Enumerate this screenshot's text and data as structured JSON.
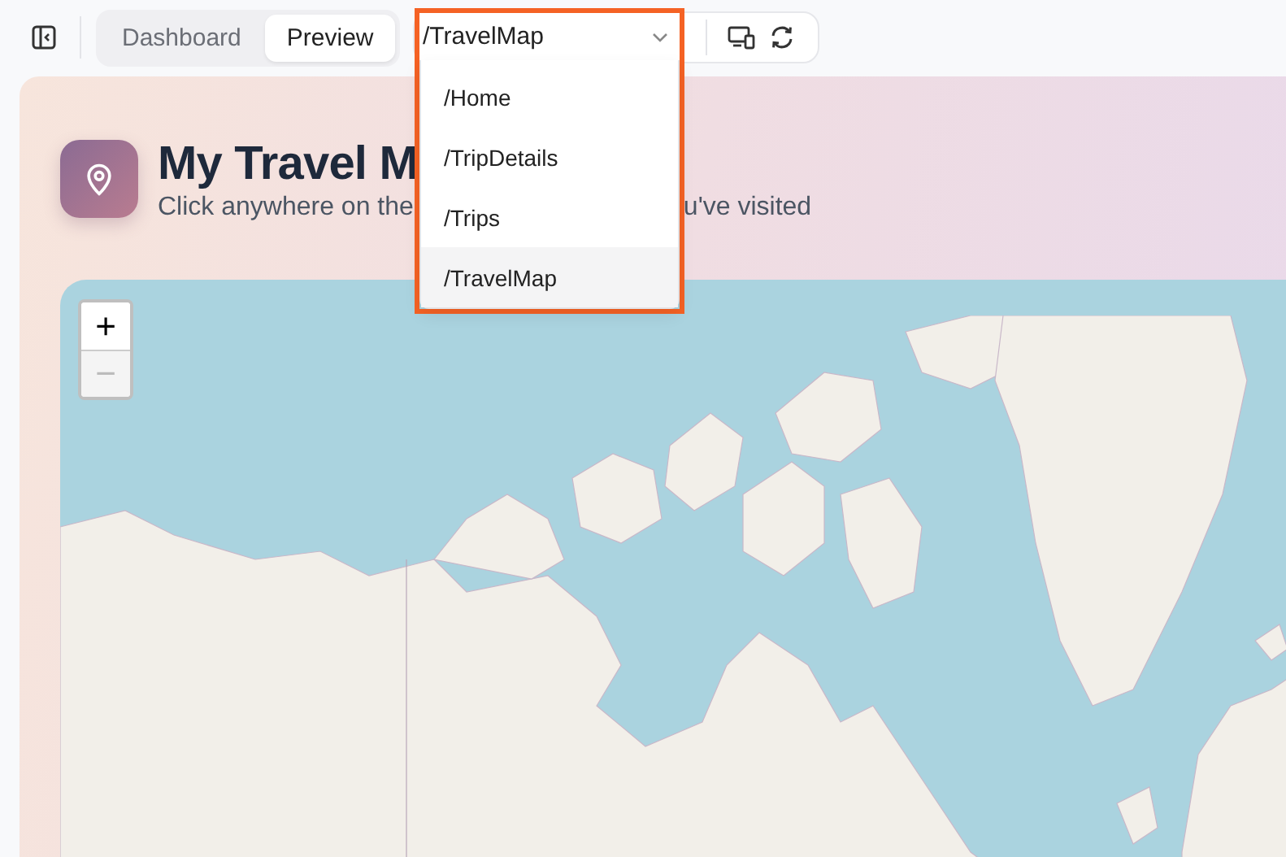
{
  "toolbar": {
    "tabs": [
      {
        "label": "Dashboard",
        "selected": false
      },
      {
        "label": "Preview",
        "selected": true
      }
    ],
    "route_select": {
      "value": "/TravelMap",
      "expanded": true
    }
  },
  "route_menu": {
    "items": [
      {
        "label": "/Home",
        "selected": false
      },
      {
        "label": "/TripDetails",
        "selected": false
      },
      {
        "label": "/Trips",
        "selected": false
      },
      {
        "label": "/TravelMap",
        "selected": true
      }
    ]
  },
  "page": {
    "title": "My Travel M",
    "subtitle_parts": [
      "Click anywhere on the",
      "u've visited"
    ]
  },
  "map": {
    "zoom_controls": [
      {
        "label": "+",
        "disabled": false
      },
      {
        "label": "−",
        "disabled": true
      }
    ]
  }
}
